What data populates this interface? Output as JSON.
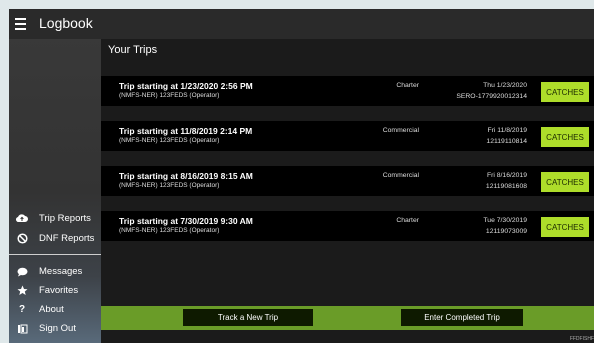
{
  "app": {
    "title": "Logbook"
  },
  "sidebar": {
    "group1": [
      {
        "label": "Trip Reports",
        "icon": "cloud-upload-icon"
      },
      {
        "label": "DNF Reports",
        "icon": "block-icon"
      }
    ],
    "group2": [
      {
        "label": "Messages",
        "icon": "chat-icon"
      },
      {
        "label": "Favorites",
        "icon": "star-icon"
      },
      {
        "label": "About",
        "icon": "question-icon"
      },
      {
        "label": "Sign Out",
        "icon": "sign-out-icon"
      }
    ]
  },
  "main": {
    "title": "Your Trips",
    "trips": [
      {
        "title": "Trip starting at 1/23/2020 2:56 PM",
        "subtitle": "(NMFS-NER) 123FEDS (Operator)",
        "type": "Charter",
        "date": "Thu 1/23/2020",
        "id": "SERO-1779920012314",
        "button": "CATCHES"
      },
      {
        "title": "Trip starting at 11/8/2019 2:14 PM",
        "subtitle": "(NMFS-NER) 123FEDS (Operator)",
        "type": "Commercial",
        "date": "Fri 11/8/2019",
        "id": "12119110814",
        "button": "CATCHES"
      },
      {
        "title": "Trip starting at 8/16/2019 8:15 AM",
        "subtitle": "(NMFS-NER) 123FEDS (Operator)",
        "type": "Commercial",
        "date": "Fri 8/16/2019",
        "id": "12119081608",
        "button": "CATCHES"
      },
      {
        "title": "Trip starting at 7/30/2019 9:30 AM",
        "subtitle": "(NMFS-NER) 123FEDS (Operator)",
        "type": "Charter",
        "date": "Tue 7/30/2019",
        "id": "12119073009",
        "button": "CATCHES"
      }
    ]
  },
  "bottom": {
    "track_label": "Track a New Trip",
    "enter_label": "Enter Completed Trip",
    "footer": "FFDFISHF"
  },
  "colors": {
    "accent": "#aedd2a",
    "bar": "#6a9c28"
  }
}
